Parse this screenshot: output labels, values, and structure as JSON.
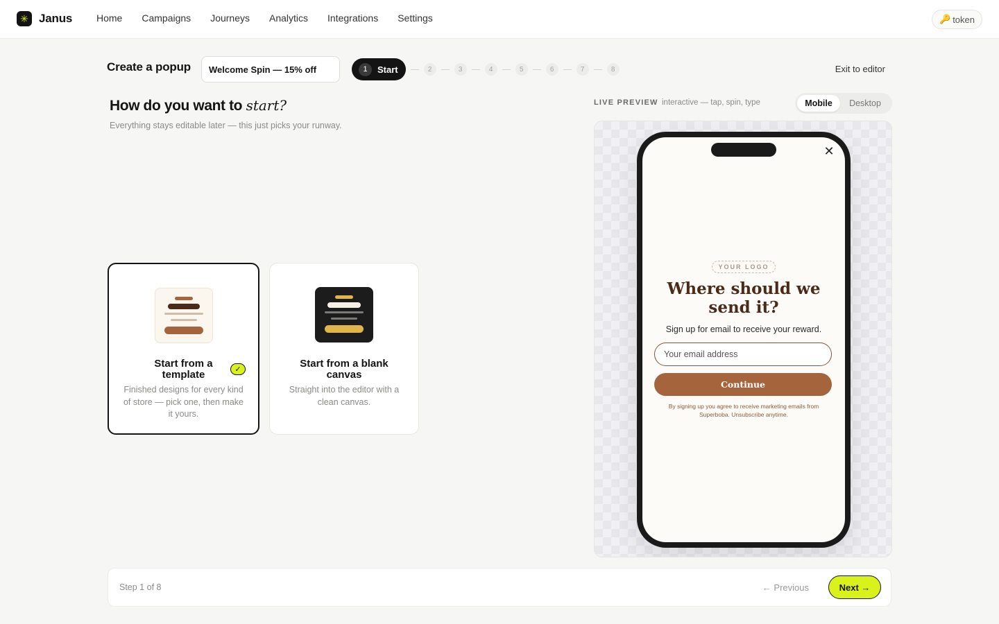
{
  "nav": {
    "brand_icon": "✳",
    "brand_name": "Janus",
    "links": [
      "Home",
      "Campaigns",
      "Journeys",
      "Analytics",
      "Integrations",
      "Settings"
    ],
    "token_icon": "🔑",
    "token_label": "token"
  },
  "header": {
    "title": "Create a popup",
    "popup_name_value": "Welcome Spin — 15% off",
    "steps": {
      "active_number": "1",
      "active_label": "Start",
      "others": [
        "2",
        "3",
        "4",
        "5",
        "6",
        "7",
        "8"
      ]
    },
    "exit_label": "Exit to editor"
  },
  "main": {
    "heading_plain": "How do you want to",
    "heading_emphasis": "start?",
    "subheading": "Everything stays editable later — this just picks your runway.",
    "options": [
      {
        "title": "Start from a template",
        "description": "Finished designs for every kind of store — pick one, then make it yours.",
        "selected": true,
        "check_icon": "✓"
      },
      {
        "title": "Start from a blank canvas",
        "description": "Straight into the editor with a clean canvas.",
        "selected": false
      }
    ]
  },
  "preview": {
    "label": "LIVE PREVIEW",
    "hint": "interactive — tap, spin, type",
    "device_options": [
      "Mobile",
      "Desktop"
    ],
    "device_selected": "Mobile",
    "popup": {
      "close_icon": "✕",
      "logo_placeholder": "YOUR LOGO",
      "title": "Where should we send it?",
      "subtitle": "Sign up for email to receive your reward.",
      "email_placeholder": "Your email address",
      "button_label": "Continue",
      "legal": "By signing up you agree to receive marketing emails from Superboba. Unsubscribe anytime.",
      "colors": {
        "background": "#fdfbf7",
        "title": "#4a2a18",
        "button": "#a5643b",
        "legal": "#8b5a3c"
      }
    }
  },
  "footer": {
    "step_text": "Step 1 of 8",
    "previous_label": "← Previous",
    "next_label": "Next →"
  },
  "colors": {
    "accent": "#d9f21b",
    "ink": "#141414",
    "page_bg": "#f6f6f4"
  }
}
